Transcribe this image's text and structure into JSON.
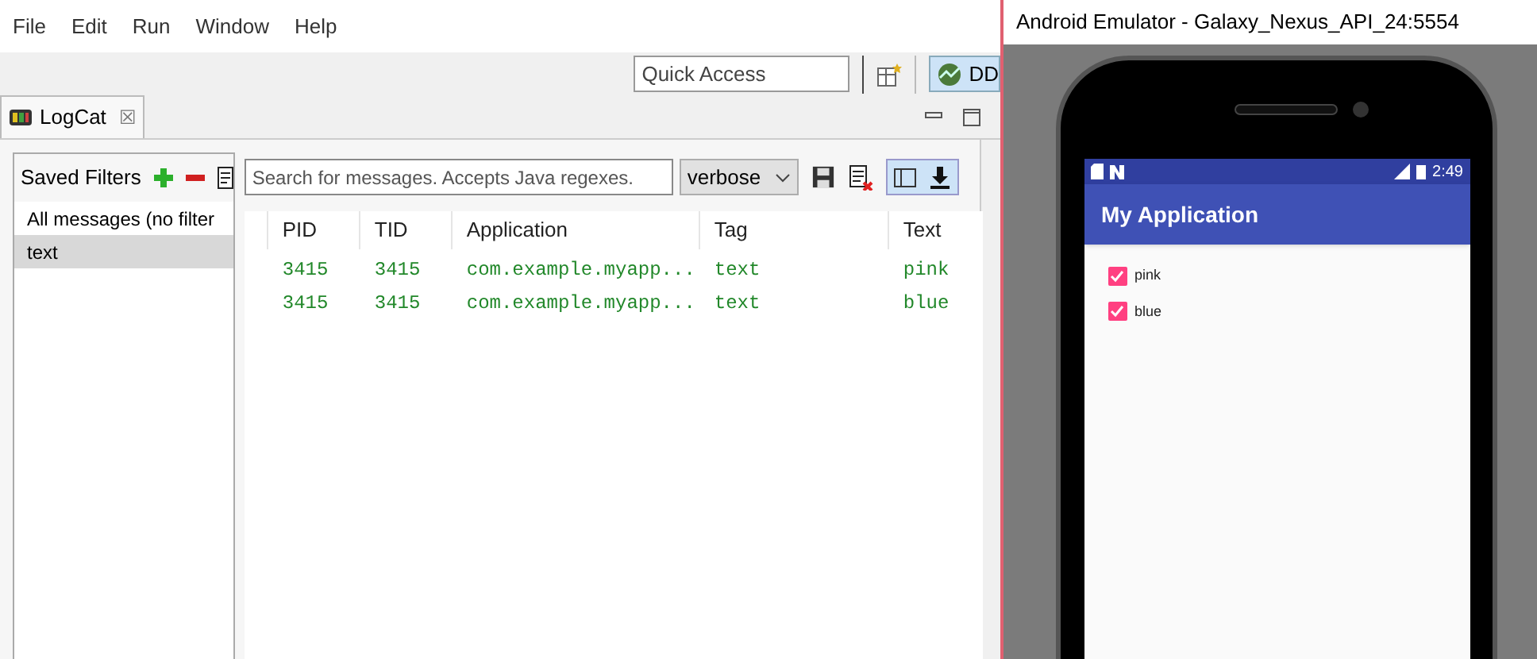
{
  "menu": [
    "File",
    "Edit",
    "Run",
    "Window",
    "Help"
  ],
  "quick_access": {
    "placeholder": "Quick Access"
  },
  "perspective": {
    "label": "DD"
  },
  "view_tab": {
    "label": "LogCat",
    "close": "☒"
  },
  "saved_filters": {
    "title": "Saved Filters",
    "items": [
      {
        "label": "All messages (no filter",
        "selected": false
      },
      {
        "label": "text",
        "selected": true
      }
    ]
  },
  "search": {
    "placeholder": "Search for messages. Accepts Java regexes."
  },
  "level_select": {
    "value": "verbose"
  },
  "toggles": [
    {
      "kind": "panel",
      "on": true
    },
    {
      "kind": "scroll-lock",
      "on": true
    }
  ],
  "table": {
    "columns": [
      "PID",
      "TID",
      "Application",
      "Tag",
      "Text"
    ],
    "rows": [
      [
        "3415",
        "3415",
        "com.example.myapp...",
        "text",
        "pink"
      ],
      [
        "3415",
        "3415",
        "com.example.myapp...",
        "text",
        "blue"
      ]
    ]
  },
  "emulator": {
    "title": "Android Emulator - Galaxy_Nexus_API_24:5554",
    "time": "2:49",
    "app_title": "My Application",
    "checkboxes": [
      {
        "label": "pink",
        "checked": true
      },
      {
        "label": "blue",
        "checked": true
      }
    ]
  }
}
